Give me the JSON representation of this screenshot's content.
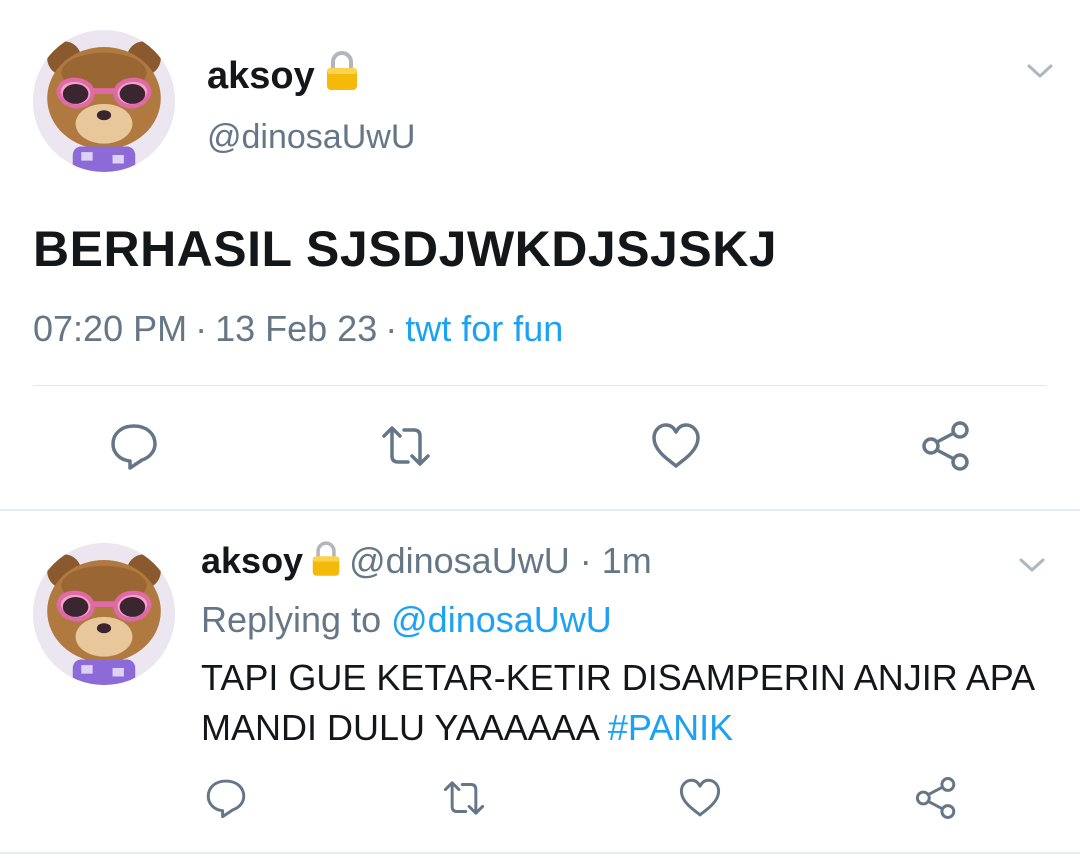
{
  "colors": {
    "text": "#14171a",
    "muted": "#657786",
    "accent": "#1da1f2",
    "divider": "#e1e8ed"
  },
  "main_tweet": {
    "author_name": "aksoy",
    "author_handle": "@dinosaUwU",
    "text": "BERHASIL SJSDJWKDJSJSKJ",
    "time": "07:20 PM",
    "date": "13 Feb 23",
    "separator": "·",
    "source": "twt for fun",
    "icons": {
      "lock": "lock-icon",
      "menu": "chevron-down-icon",
      "actions": [
        "reply-icon",
        "retweet-icon",
        "like-icon",
        "share-icon"
      ]
    }
  },
  "reply_tweet": {
    "author_name": "aksoy",
    "author_handle": "@dinosaUwU",
    "separator": "·",
    "time_ago": "1m",
    "replying_label": "Replying to",
    "replying_to": "@dinosaUwU",
    "text": "TAPI GUE KETAR-KETIR DISAMPERIN ANJIR APA MANDI DULU YAAAAAA",
    "hashtag": "#PANIK",
    "icons": {
      "lock": "lock-icon",
      "menu": "chevron-down-icon",
      "actions": [
        "reply-icon",
        "retweet-icon",
        "like-icon",
        "share-icon"
      ]
    }
  }
}
